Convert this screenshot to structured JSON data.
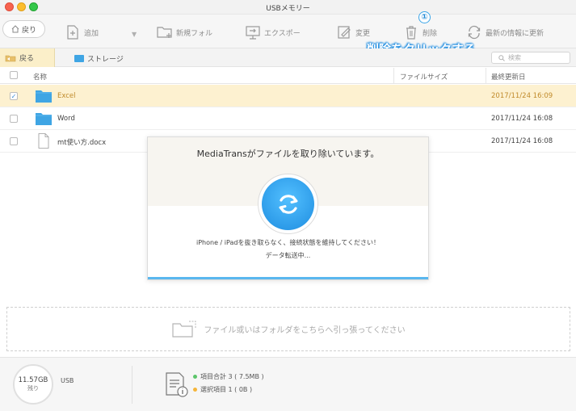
{
  "window": {
    "title": "USBメモリー"
  },
  "toolbar": {
    "back": "戻り",
    "add": "追加",
    "new_folder": "新規フォル",
    "export": "エクスポー",
    "edit": "変更",
    "delete": "削除",
    "refresh": "最新の情報に更新",
    "dropdown": "▼"
  },
  "annotation": {
    "step_number": "①",
    "text": "削除をクリックする"
  },
  "nav": {
    "back": "戻る",
    "breadcrumb": "ストレージ",
    "search_placeholder": "検索"
  },
  "table": {
    "headers": {
      "name": "名称",
      "size": "ファイルサイズ",
      "date": "最終更新日"
    },
    "rows": [
      {
        "name": "Excel",
        "type": "folder",
        "size": "",
        "date": "2017/11/24  16:09",
        "selected": true
      },
      {
        "name": "Word",
        "type": "folder",
        "size": "",
        "date": "2017/11/24  16:08",
        "selected": false
      },
      {
        "name": "mt使い方.docx",
        "type": "file",
        "size": "",
        "date": "2017/11/24  16:08",
        "selected": false
      }
    ]
  },
  "dialog": {
    "title": "MediaTransがファイルを取り除いています。",
    "message": "iPhone / iPadを抜き取らなく、接続状態を維持してください！",
    "status": "データ転送中..."
  },
  "dropzone": {
    "text": "ファイル或いはフォルダをこちらへ引っ張ってください"
  },
  "footer": {
    "storage_value": "11.57GB",
    "storage_label": "残り",
    "device": "USB",
    "total": "項目合計 3 ( 7.5MB )",
    "selected": "選択項目 1 ( 0B )"
  },
  "colors": {
    "accent": "#1e8de0",
    "selection_bg": "#fdf1d0",
    "selection_text": "#c08a2a",
    "folder": "#3fa5e4",
    "total_dot": "#5cc56a",
    "selected_dot": "#f5b53a"
  }
}
